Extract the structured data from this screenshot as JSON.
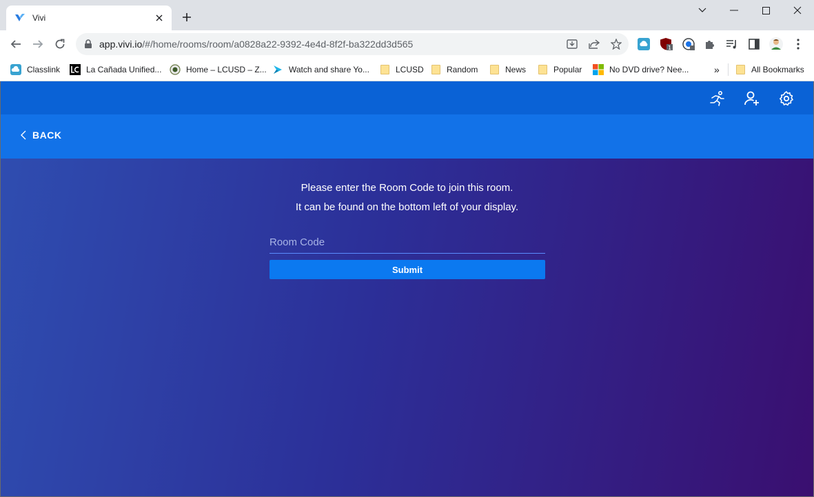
{
  "browser": {
    "tab_title": "Vivi",
    "url_host": "app.vivi.io",
    "url_path": "/#/home/rooms/room/a0828a22-9392-4e4d-8f2f-ba322dd3d565",
    "extension_badge": "1"
  },
  "bookmarks": {
    "items": [
      {
        "label": "Classlink",
        "icon": "cloud-icon"
      },
      {
        "label": "La Cañada Unified...",
        "icon": "lc-logo-icon"
      },
      {
        "label": "Home – LCUSD – Z...",
        "icon": "globe-icon"
      },
      {
        "label": "Watch and share Yo...",
        "icon": "play-icon"
      },
      {
        "label": "LCUSD",
        "icon": "folder-icon"
      },
      {
        "label": "Random",
        "icon": "folder-icon"
      },
      {
        "label": "News",
        "icon": "folder-icon"
      },
      {
        "label": "Popular",
        "icon": "folder-icon"
      },
      {
        "label": "No DVD drive? Nee...",
        "icon": "windows-logo-icon"
      }
    ],
    "overflow": "»",
    "all_bookmarks": "All Bookmarks"
  },
  "app": {
    "back_label": "BACK",
    "message_line1": "Please enter the Room Code to join this room.",
    "message_line2": "It can be found on the bottom left of your display.",
    "room_code_placeholder": "Room Code",
    "submit_label": "Submit"
  },
  "colors": {
    "header": "#0a62d6",
    "back_bar": "#1272e8",
    "submit": "#0b79f0",
    "gradient_start": "#2f4db0",
    "gradient_end": "#3a0f70"
  }
}
